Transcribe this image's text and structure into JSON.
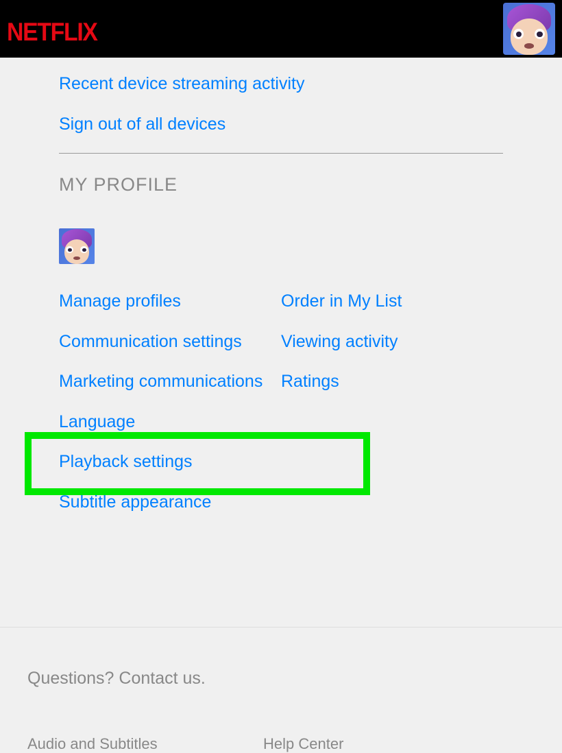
{
  "brand": "NETFLIX",
  "links": {
    "recent_activity": "Recent device streaming activity",
    "sign_out_all": "Sign out of all devices"
  },
  "profile": {
    "section_title": "MY PROFILE",
    "links_left": {
      "manage_profiles": "Manage profiles",
      "communication_settings": "Communication settings",
      "marketing_communications": "Marketing communications",
      "language": "Language",
      "playback_settings": "Playback settings",
      "subtitle_appearance": "Subtitle appearance"
    },
    "links_right": {
      "order_my_list": "Order in My List",
      "viewing_activity": "Viewing activity",
      "ratings": "Ratings"
    }
  },
  "footer": {
    "contact": "Questions? Contact us.",
    "links": {
      "audio_subtitles": "Audio and Subtitles",
      "help_center": "Help Center"
    }
  }
}
